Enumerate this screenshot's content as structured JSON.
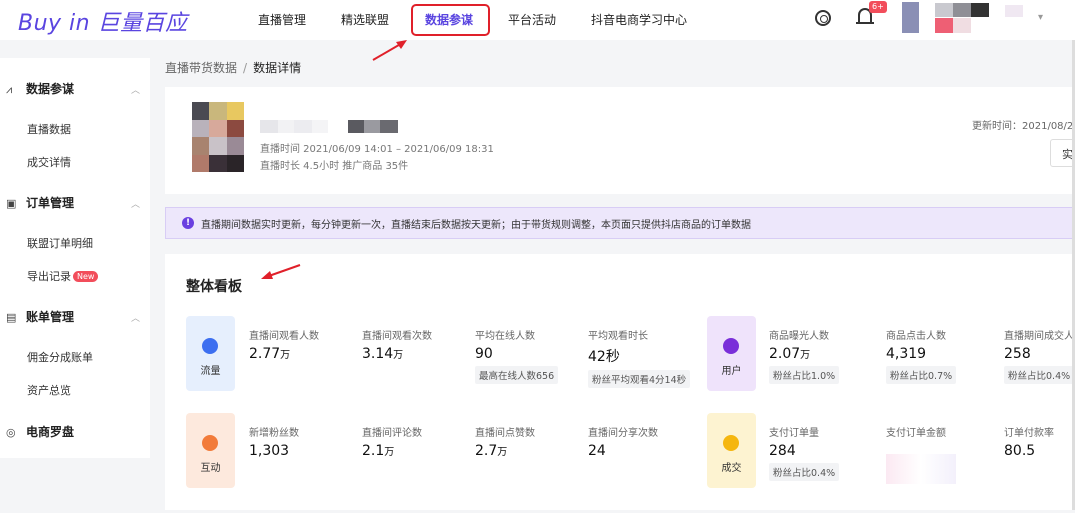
{
  "brand": {
    "logo_text": "Buy in 巨量百应"
  },
  "nav": {
    "items": [
      "直播管理",
      "精选联盟",
      "数据参谋",
      "平台活动",
      "抖音电商学习中心"
    ],
    "active_index": 2,
    "notification_count": "6+"
  },
  "sidebar": {
    "groups": [
      {
        "label": "数据参谋",
        "icon": "chart-icon",
        "items": [
          "直播数据",
          "成交详情"
        ]
      },
      {
        "label": "订单管理",
        "icon": "order-icon",
        "items": [
          "联盟订单明细",
          "导出记录"
        ],
        "badge": "New"
      },
      {
        "label": "账单管理",
        "icon": "bill-icon",
        "items": [
          "佣金分成账单",
          "资产总览"
        ]
      },
      {
        "label": "电商罗盘",
        "icon": "compass-icon",
        "items": []
      }
    ]
  },
  "breadcrumb": {
    "parent": "直播带货数据",
    "separator": "/",
    "current": "数据详情"
  },
  "live_info": {
    "time_line": "直播时间  2021/06/09 14:01 – 2021/06/09 18:31",
    "duration_line": "直播时长  4.5小时  推广商品  35件",
    "update_time": "更新时间：2021/08/2",
    "action_label": "实"
  },
  "notice": {
    "text": "直播期间数据实时更新，每分钟更新一次，直播结束后数据按天更新；由于带货规则调整，本页面只提供抖店商品的订单数据"
  },
  "board": {
    "title": "整体看板",
    "categories": [
      {
        "label": "流量",
        "icon": "traffic-icon",
        "color": "#3d6ff0",
        "bg": "#e6effd"
      },
      {
        "label": "用户",
        "icon": "user-icon",
        "color": "#7a2fd9",
        "bg": "#efe3fb"
      },
      {
        "label": "互动",
        "icon": "interaction-icon",
        "color": "#f27b3a",
        "bg": "#fde9dd"
      },
      {
        "label": "成交",
        "icon": "deal-icon",
        "color": "#f5b60f",
        "bg": "#fdf3d1"
      }
    ],
    "metrics": [
      {
        "label": "直播间观看人数",
        "value": "2.77",
        "unit": "万"
      },
      {
        "label": "直播间观看次数",
        "value": "3.14",
        "unit": "万"
      },
      {
        "label": "平均在线人数",
        "value": "90",
        "unit": "",
        "sub": "最高在线人数656"
      },
      {
        "label": "平均观看时长",
        "value": "42秒",
        "unit": "",
        "sub": "粉丝平均观看4分14秒"
      },
      {
        "label": "商品曝光人数",
        "value": "2.07",
        "unit": "万",
        "sub": "粉丝占比1.0%"
      },
      {
        "label": "商品点击人数",
        "value": "4,319",
        "unit": "",
        "sub": "粉丝占比0.7%"
      },
      {
        "label": "直播期间成交人",
        "value": "258",
        "unit": "",
        "sub": "粉丝占比0.4%"
      },
      {
        "label": "新增粉丝数",
        "value": "1,303",
        "unit": ""
      },
      {
        "label": "直播间评论数",
        "value": "2.1",
        "unit": "万"
      },
      {
        "label": "直播间点赞数",
        "value": "2.7",
        "unit": "万"
      },
      {
        "label": "直播间分享次数",
        "value": "24",
        "unit": ""
      },
      {
        "label": "支付订单量",
        "value": "284",
        "unit": "",
        "sub": "粉丝占比0.4%"
      },
      {
        "label": "支付订单金额",
        "value": "",
        "unit": ""
      },
      {
        "label": "订单付款率",
        "value": "80.5",
        "unit": ""
      }
    ]
  },
  "colors": {
    "accent": "#5a45e0",
    "annotation_red": "#e0202a",
    "badge_red": "#f24d5b"
  }
}
